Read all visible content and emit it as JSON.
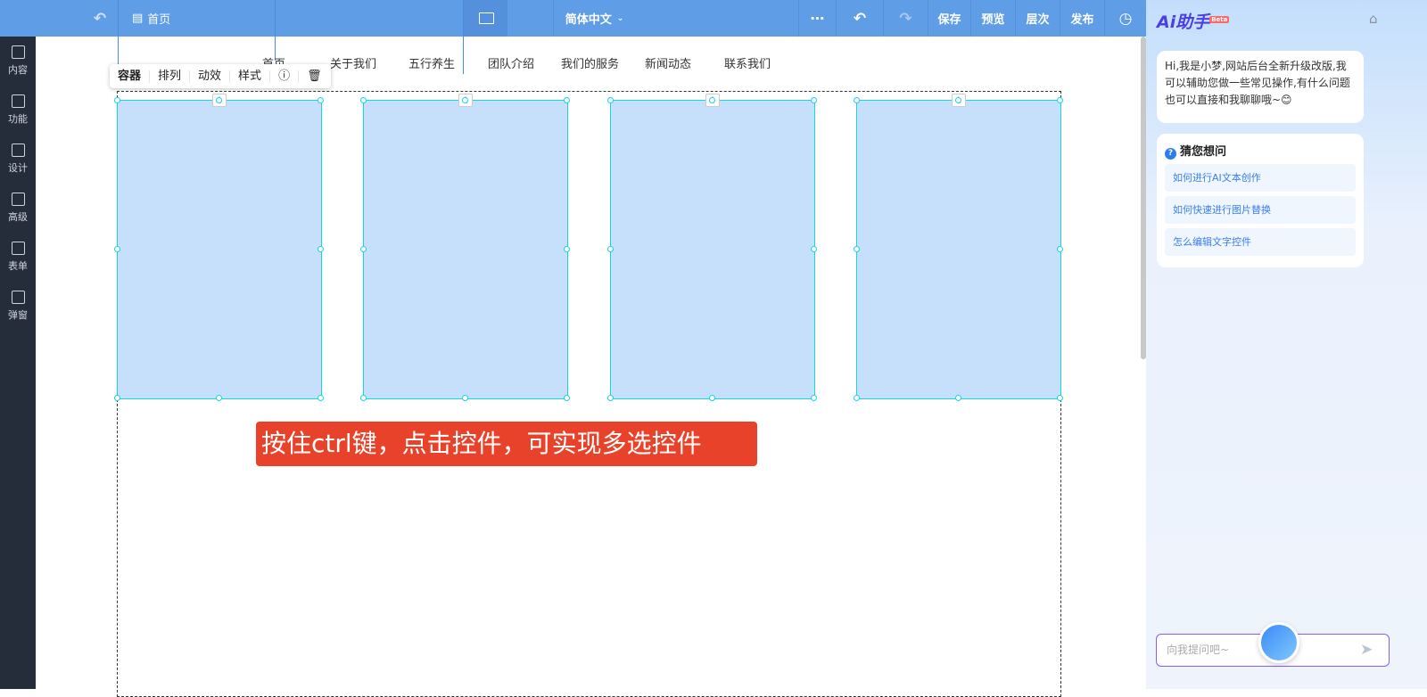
{
  "topbar": {
    "page": "首页",
    "language": "简体中文",
    "save": "保存",
    "preview": "预览",
    "layers": "层次",
    "publish": "发布"
  },
  "sidebar": [
    "内容",
    "功能",
    "设计",
    "高级",
    "表单",
    "弹窗"
  ],
  "nav": [
    "首页",
    "关于我们",
    "五行养生",
    "团队介绍",
    "我们的服务",
    "新闻动态",
    "联系我们"
  ],
  "float_toolbar": [
    "容器",
    "排列",
    "动效",
    "样式"
  ],
  "tip": "按住ctrl键，点击控件，可实现多选控件",
  "assistant": {
    "title": "Ai助手",
    "badge": "Beta",
    "greeting": "Hi,我是小梦,网站后台全新升级改版,我可以辅助您做一些常见操作,有什么问题也可以直接和我聊聊哦~😊",
    "guess_title": "猜您想问",
    "questions": [
      "如何进行AI文本创作",
      "如何快速进行图片替换",
      "怎么编辑文字控件"
    ],
    "input_placeholder": "向我提问吧~"
  },
  "colors": {
    "topbar": "#5f9de6",
    "sidebar": "#252d3a",
    "tip": "#e8432a"
  }
}
